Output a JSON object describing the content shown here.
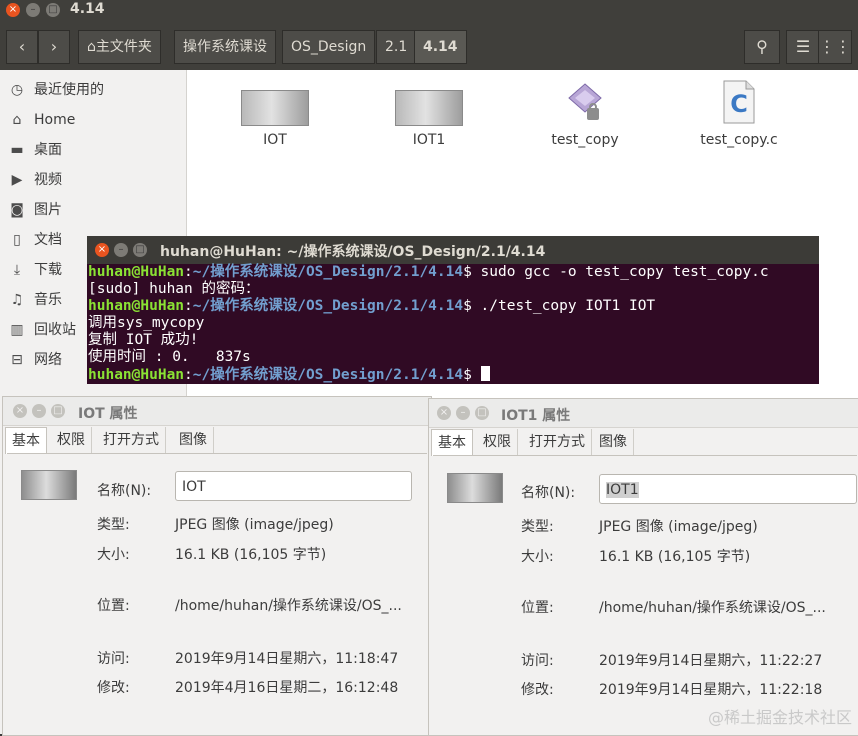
{
  "file_manager": {
    "title": "4.14",
    "back_icon": "‹",
    "forward_icon": "›",
    "breadcrumbs": [
      "主文件夹",
      "操作系统课设",
      "OS_Design",
      "2.1",
      "4.14"
    ],
    "sidebar": [
      {
        "icon": "clock-icon",
        "label": "最近使用的"
      },
      {
        "icon": "home-icon",
        "label": "Home"
      },
      {
        "icon": "folder-icon",
        "label": "桌面"
      },
      {
        "icon": "video-icon",
        "label": "视频"
      },
      {
        "icon": "camera-icon",
        "label": "图片"
      },
      {
        "icon": "document-icon",
        "label": "文档"
      },
      {
        "icon": "download-icon",
        "label": "下载"
      },
      {
        "icon": "music-icon",
        "label": "音乐"
      },
      {
        "icon": "trash-icon",
        "label": "回收站"
      },
      {
        "icon": "network-icon",
        "label": "网络"
      }
    ],
    "files": [
      {
        "name": "IOT",
        "icon": "image-thumbnail"
      },
      {
        "name": "IOT1",
        "icon": "image-thumbnail"
      },
      {
        "name": "test_copy",
        "icon": "executable-icon"
      },
      {
        "name": "test_copy.c",
        "icon": "c-source-icon"
      }
    ]
  },
  "terminal": {
    "title": "huhan@HuHan: ~/操作系统课设/OS_Design/2.1/4.14",
    "prompt_user": "huhan@HuHan",
    "prompt_path": "~/操作系统课设/OS_Design/2.1/4.14",
    "lines": [
      {
        "type": "prompt",
        "cmd": "$ sudo gcc -o test_copy test_copy.c"
      },
      {
        "type": "out",
        "text": "[sudo] huhan 的密码："
      },
      {
        "type": "prompt",
        "cmd": "$ ./test_copy IOT1 IOT"
      },
      {
        "type": "out",
        "text": "调用sys_mycopy"
      },
      {
        "type": "out",
        "text": "复制 IOT 成功!"
      },
      {
        "type": "out",
        "text": "使用时间 : 0.   837s"
      },
      {
        "type": "prompt",
        "cmd": "$ "
      }
    ]
  },
  "dialog_left": {
    "title": "IOT 属性",
    "tabs": [
      "基本",
      "权限",
      "打开方式",
      "图像"
    ],
    "name_label": "名称(N):",
    "name_value": "IOT",
    "type_label": "类型:",
    "type_value": "JPEG 图像 (image/jpeg)",
    "size_label": "大小:",
    "size_value": "16.1 KB (16,105 字节)",
    "location_label": "位置:",
    "location_value": "/home/huhan/操作系统课设/OS_...",
    "accessed_label": "访问:",
    "accessed_value": "2019年9月14日星期六，11:18:47",
    "modified_label": "修改:",
    "modified_value": "2019年4月16日星期二，16:12:48"
  },
  "dialog_right": {
    "title": "IOT1 属性",
    "tabs": [
      "基本",
      "权限",
      "打开方式",
      "图像"
    ],
    "name_label": "名称(N):",
    "name_value": "IOT1",
    "type_label": "类型:",
    "type_value": "JPEG 图像 (image/jpeg)",
    "size_label": "大小:",
    "size_value": "16.1 KB (16,105 字节)",
    "location_label": "位置:",
    "location_value": "/home/huhan/操作系统课设/OS_...",
    "accessed_label": "访问:",
    "accessed_value": "2019年9月14日星期六，11:22:27",
    "modified_label": "修改:",
    "modified_value": "2019年9月14日星期六，11:22:18"
  },
  "watermark": "@稀土掘金技术社区",
  "colors": {
    "terminal_bg": "#300a24",
    "prompt_user": "#8ae234",
    "prompt_path": "#729fcf",
    "close_button": "#e95420"
  }
}
